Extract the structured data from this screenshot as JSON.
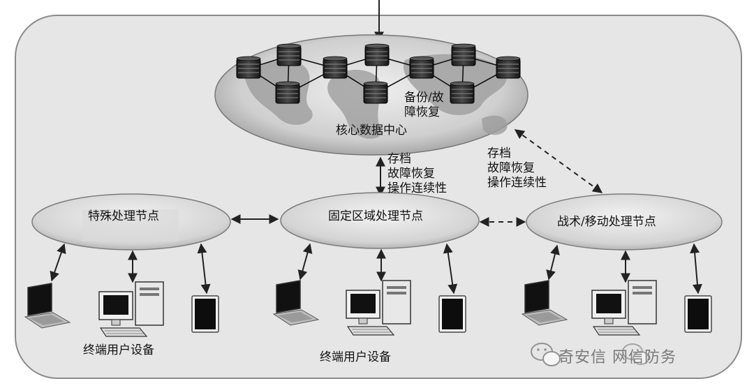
{
  "core": {
    "label": "核心数据中心",
    "backup_line1": "备份/故",
    "backup_line2": "障恢复"
  },
  "links": {
    "vertical_line1": "存档",
    "vertical_line2": "故障恢复",
    "vertical_line3": "操作连续性",
    "diagonal_line1": "存档",
    "diagonal_line2": "故障恢复",
    "diagonal_line3": "操作连续性"
  },
  "nodes": {
    "special": "特殊处理节点",
    "fixed": "固定区域处理节点",
    "tactical": "战术/移动处理节点"
  },
  "terminals": {
    "left_label": "终端用户设备",
    "center_label": "终端用户设备"
  },
  "watermark": {
    "text": "奇安信  网信防务",
    "icon": "wechat-icon"
  }
}
